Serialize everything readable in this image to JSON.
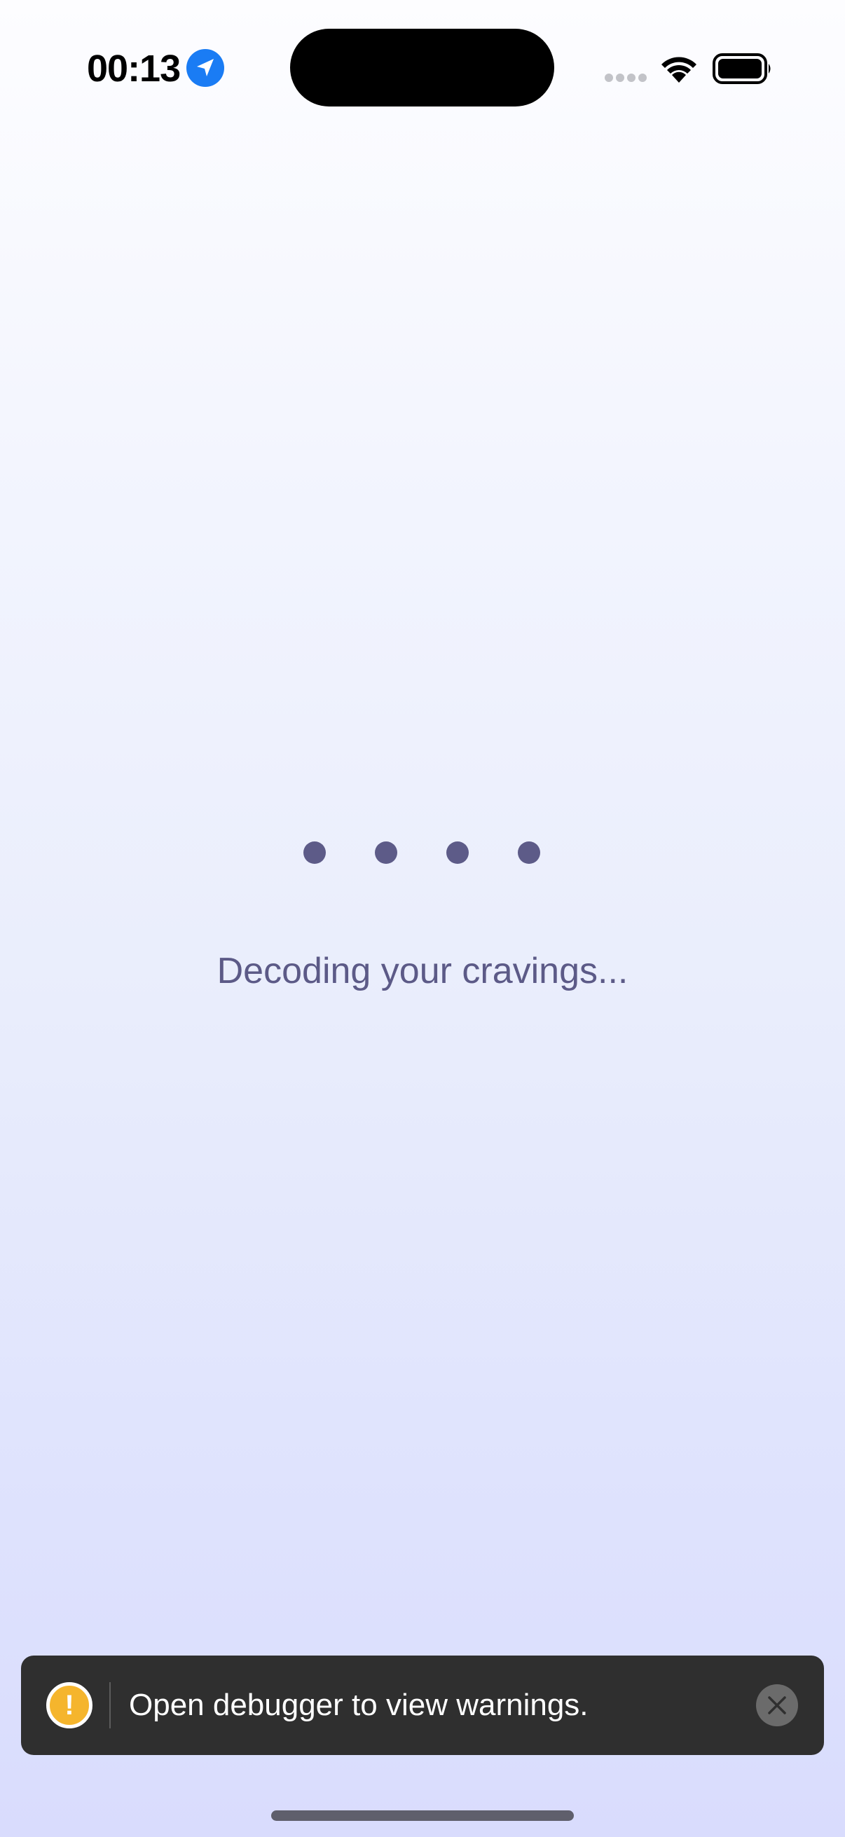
{
  "status_bar": {
    "time": "00:13",
    "location_icon": "location-arrow-icon",
    "signal_icon": "cellular-signal-icon",
    "wifi_icon": "wifi-icon",
    "battery_icon": "battery-icon",
    "location_color": "#1a7cf4"
  },
  "loading": {
    "dots_count": 4,
    "dot_color": "#5d5b88",
    "message": "Decoding your cravings..."
  },
  "debugger_toast": {
    "icon": "warning-icon",
    "icon_color": "#f5b52d",
    "message": "Open debugger to view warnings.",
    "close_icon": "close-icon"
  }
}
